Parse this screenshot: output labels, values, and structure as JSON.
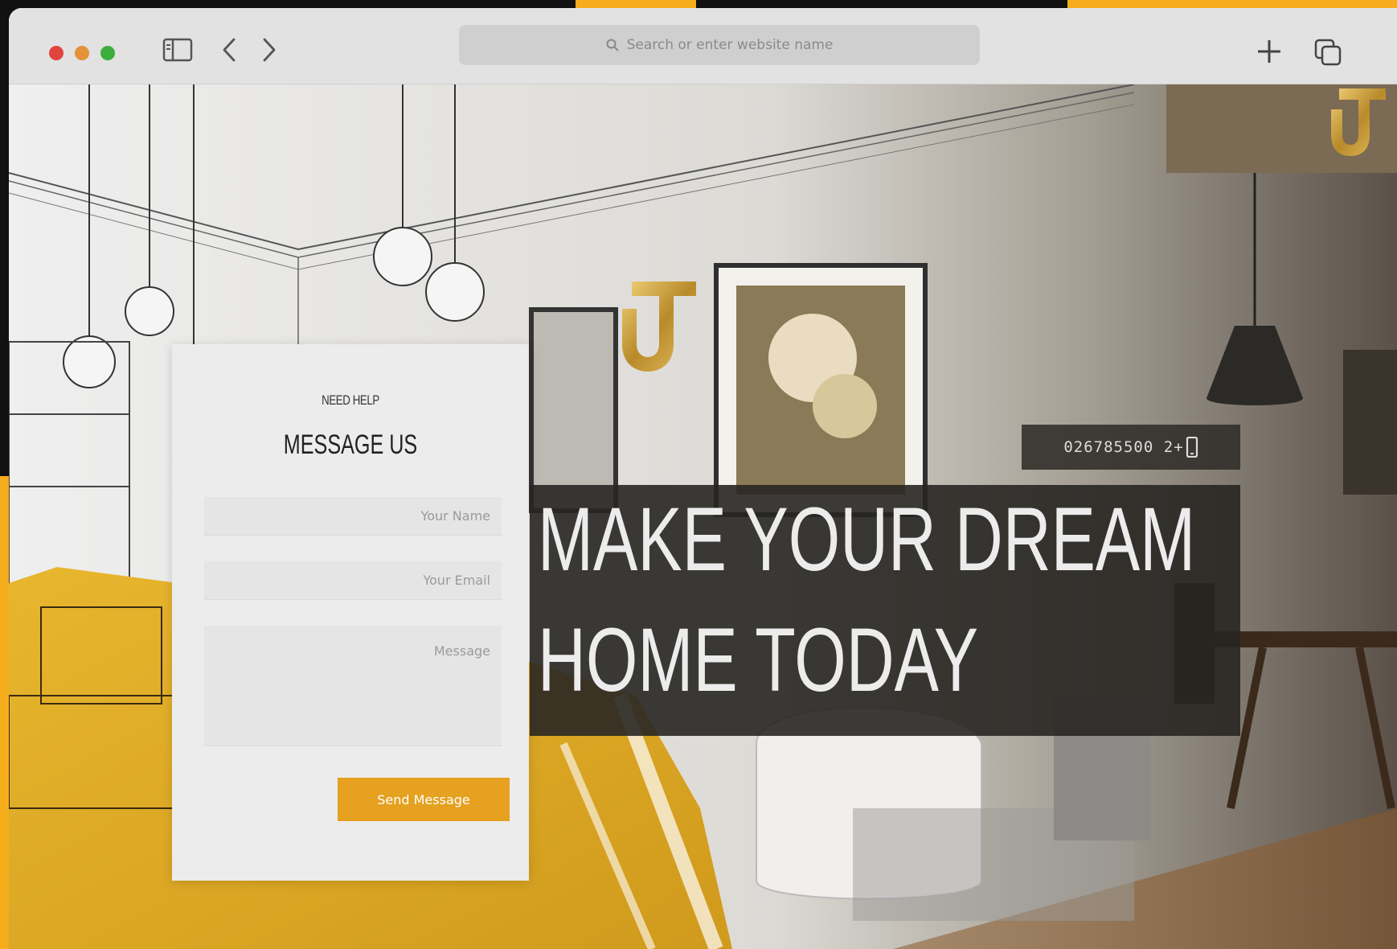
{
  "browser": {
    "address_placeholder": "Search or enter website name",
    "traffic_colors": [
      "#e0443e",
      "#e5913a",
      "#3cae3c"
    ],
    "icons": [
      "sidebar-icon",
      "back-arrow-icon",
      "forward-arrow-icon",
      "search-icon",
      "new-tab-plus-icon",
      "tabs-overview-icon"
    ]
  },
  "contact": {
    "kicker": "NEED HELP",
    "title": "MESSAGE US",
    "name_placeholder": "Your Name",
    "email_placeholder": "Your Email",
    "message_placeholder": "Message",
    "send_label": "Send Message"
  },
  "hero": {
    "phone": "026785500 2+",
    "headline_line1": "MAKE YOUR DREAM",
    "headline_line2": "HOME TODAY"
  },
  "colors": {
    "accent": "#e5a11f",
    "dark_overlay": "#2a2622"
  }
}
